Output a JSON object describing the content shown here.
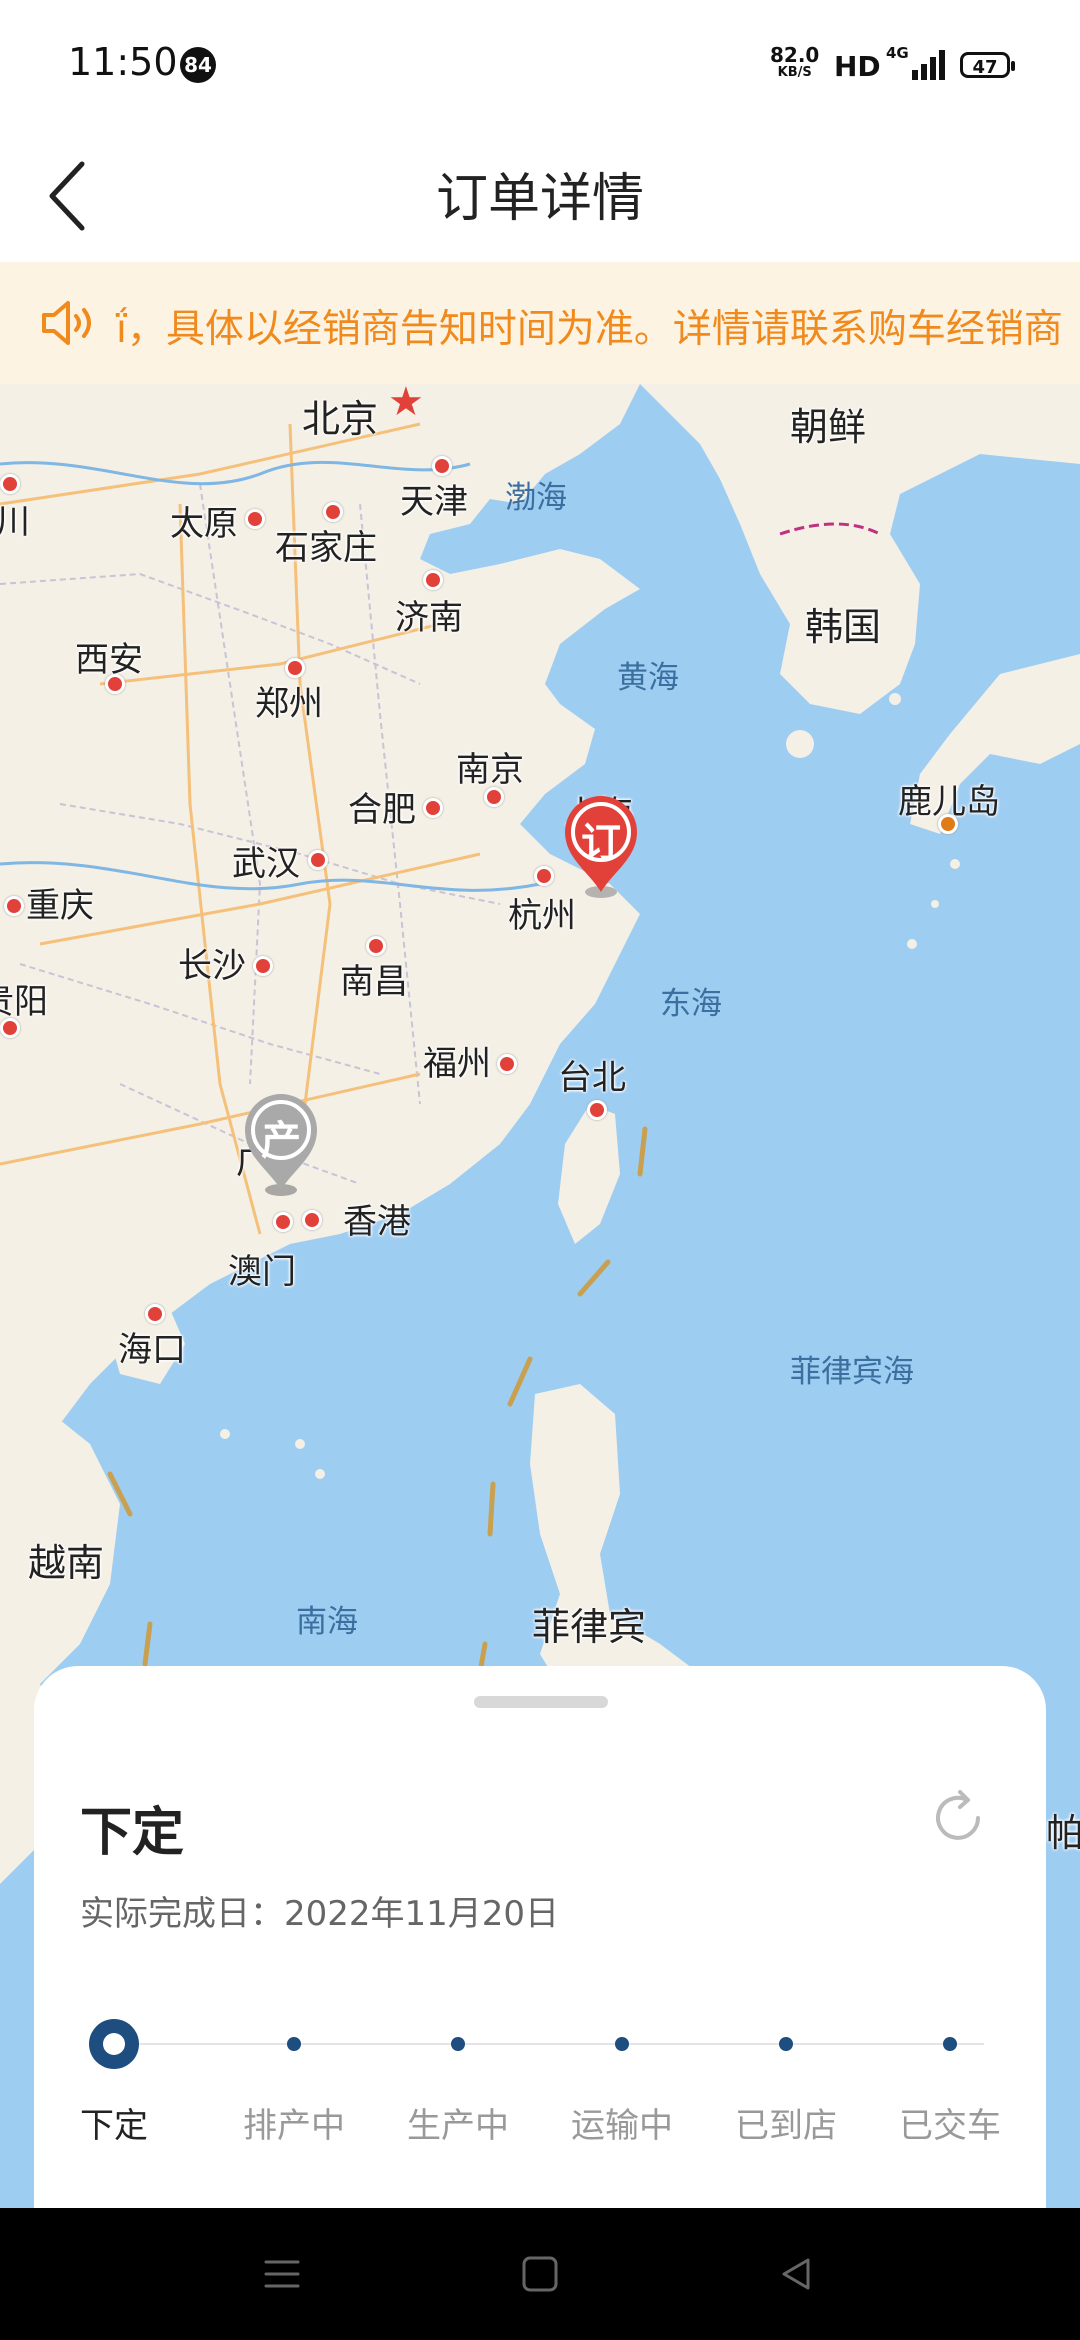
{
  "status_bar": {
    "time": "11:50",
    "notification_count": "84",
    "net_speed": "82.0",
    "net_speed_unit": "KB/S",
    "hd": "HD",
    "network": "4G",
    "battery": "47"
  },
  "header": {
    "title": "订单详情"
  },
  "notice": {
    "text": "ḯ，具体以经销商告知时间为准。详情请联系购车经销商"
  },
  "map": {
    "labels": {
      "beijing": "北京",
      "tianjin": "天津",
      "bohai": "渤海",
      "chaoxian": "朝鲜",
      "yinchuan": "银川",
      "taiyuan": "太原",
      "shijiazhuang": "石家庄",
      "jinan": "济南",
      "hanguo": "韩国",
      "xian": "西安",
      "zhengzhou": "郑州",
      "huanghai": "黄海",
      "nanjing": "南京",
      "hefei": "合肥",
      "shanghai": "上海",
      "luerdao": "鹿儿岛",
      "wuhan": "武汉",
      "chongqing": "重庆",
      "hangzhou": "杭州",
      "changsha": "长沙",
      "nanchang": "南昌",
      "guiyang": "贵阳",
      "donghai": "东海",
      "fuzhou": "福州",
      "taibei": "台北",
      "guangzhou": "广",
      "xianggang": "香港",
      "aomen": "澳门",
      "haikou": "海口",
      "feilvbinhai": "菲律宾海",
      "yuenan": "越南",
      "nanhai": "南海",
      "feilvbin": "菲律宾",
      "palau": "帕"
    },
    "order_marker": "订",
    "production_marker": "产"
  },
  "order": {
    "status_title": "下定",
    "completion_date": "实际完成日：2022年11月20日",
    "steps": [
      "下定",
      "排产中",
      "生产中",
      "运输中",
      "已到店",
      "已交车"
    ],
    "current_step": 0
  },
  "colors": {
    "accent": "#1e4d80",
    "notice": "#f08a1c",
    "marker": "#e2413a"
  }
}
